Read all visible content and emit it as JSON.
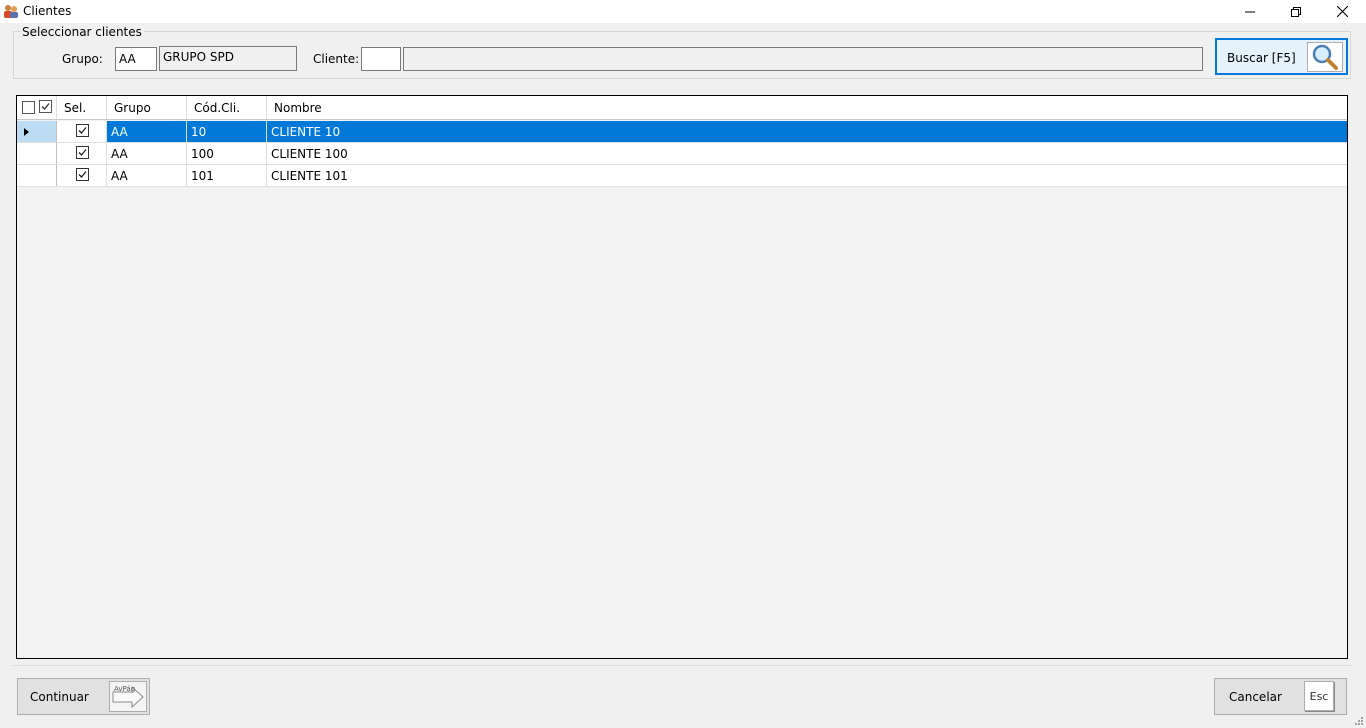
{
  "window": {
    "title": "Clientes"
  },
  "filter": {
    "group_title": "Seleccionar clientes",
    "grupo_label": "Grupo:",
    "grupo_code": "AA",
    "grupo_name": "GRUPO SPD",
    "cliente_label": "Cliente:",
    "cliente_code": "",
    "cliente_name": "",
    "search_button": "Buscar [F5]"
  },
  "grid": {
    "columns": [
      "Sel.",
      "Grupo",
      "Cód.Cli.",
      "Nombre"
    ],
    "rows": [
      {
        "selected": true,
        "checked": true,
        "grupo": "AA",
        "codigo": "10",
        "nombre": "CLIENTE 10"
      },
      {
        "selected": false,
        "checked": true,
        "grupo": "AA",
        "codigo": "100",
        "nombre": "CLIENTE 100"
      },
      {
        "selected": false,
        "checked": true,
        "grupo": "AA",
        "codigo": "101",
        "nombre": "CLIENTE 101"
      }
    ]
  },
  "footer": {
    "continue_button": "Continuar",
    "continue_key": "AvPág",
    "cancel_button": "Cancelar",
    "cancel_key": "Esc"
  },
  "colors": {
    "selection": "#0078d7",
    "row_header_selected": "#bcdcf4"
  }
}
